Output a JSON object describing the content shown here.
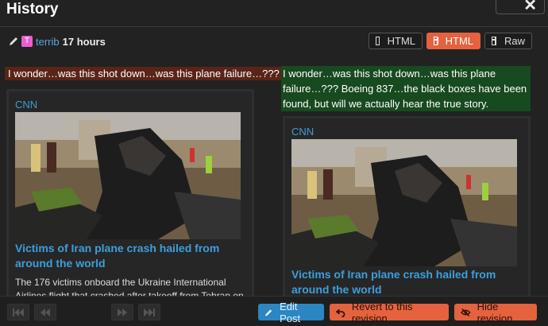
{
  "header": {
    "title": "History",
    "close_icon": "close-icon"
  },
  "revision": {
    "avatar_letter": "T",
    "avatar_color": "#e75fd1",
    "username": "terrib",
    "time": "17 hours"
  },
  "view_modes": [
    {
      "label": "HTML",
      "icon": "inline-icon",
      "active": false
    },
    {
      "label": "HTML",
      "icon": "side-by-side-icon",
      "active": true
    },
    {
      "label": "Raw",
      "icon": "side-by-side-markdown-icon",
      "active": false
    }
  ],
  "left": {
    "deleted_text": "I wonder…was this shot down…was this plane failure…???",
    "card": {
      "source": "CNN",
      "headline": "Victims of Iran plane crash hailed from around the world",
      "body": "The 176 victims onboard the Ukraine International Airlines flight that crashed after takeoff from Tehran on"
    }
  },
  "right": {
    "inserted_text": "I wonder…was this shot down…was this plane failure…??? Boeing 837…the black boxes have been found, but will we actually hear the true story.",
    "card": {
      "source": "CNN",
      "headline": "Victims of Iran plane crash hailed from around the world"
    }
  },
  "footer": {
    "edit_label": "Edit Post",
    "revert_label": "Revert to this revision",
    "hide_label": "Hide revision"
  },
  "colors": {
    "accent": "#e4623e",
    "link": "#3c9fdb",
    "deleted_bg": "#5a2416",
    "inserted_bg": "#174a1f"
  }
}
